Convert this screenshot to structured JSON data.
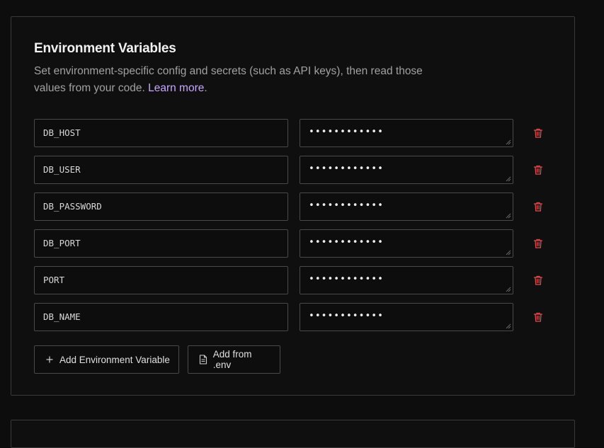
{
  "section": {
    "title": "Environment Variables",
    "description": "Set environment-specific config and secrets (such as API keys), then read those values from your code.",
    "learn_more_label": "Learn more",
    "trailing_period": "."
  },
  "variables": [
    {
      "key": "DB_HOST",
      "value": "••••••••••••"
    },
    {
      "key": "DB_USER",
      "value": "••••••••••••"
    },
    {
      "key": "DB_PASSWORD",
      "value": "••••••••••••"
    },
    {
      "key": "DB_PORT",
      "value": "••••••••••••"
    },
    {
      "key": "PORT",
      "value": "••••••••••••"
    },
    {
      "key": "DB_NAME",
      "value": "••••••••••••"
    }
  ],
  "actions": {
    "add_variable_label": "Add Environment Variable",
    "add_from_env_label": "Add from .env"
  },
  "icons": {
    "delete": "trash-icon",
    "add": "plus-icon",
    "file": "file-icon"
  },
  "colors": {
    "background": "#0d0d0d",
    "link": "#c8a6ff",
    "danger": "#e5484d",
    "border": "#4a4a4a"
  }
}
